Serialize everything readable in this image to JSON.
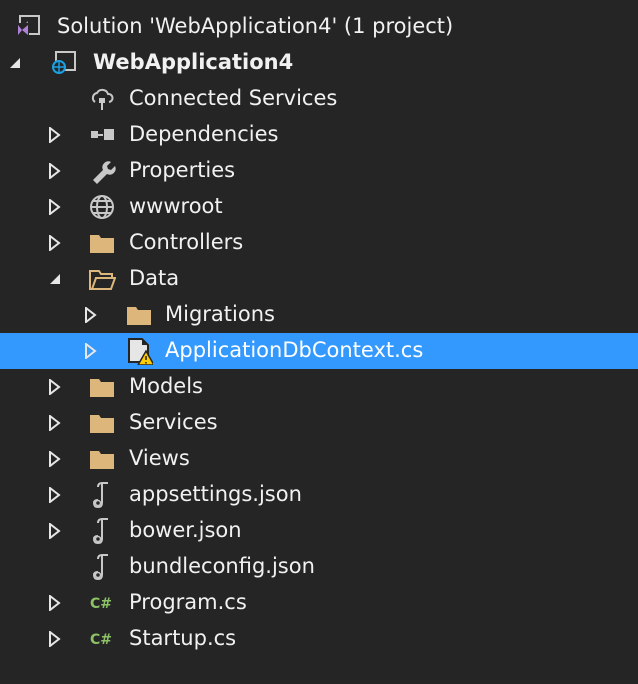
{
  "solution": {
    "label": "Solution 'WebApplication4' (1 project)"
  },
  "project": {
    "label": "WebApplication4"
  },
  "items": [
    {
      "label": "Connected Services",
      "icon": "connected-services-icon",
      "level": 2,
      "arrow": "none"
    },
    {
      "label": "Dependencies",
      "icon": "dependencies-icon",
      "level": 2,
      "arrow": "collapsed"
    },
    {
      "label": "Properties",
      "icon": "wrench-icon",
      "level": 2,
      "arrow": "collapsed"
    },
    {
      "label": "wwwroot",
      "icon": "globe-icon",
      "level": 2,
      "arrow": "collapsed"
    },
    {
      "label": "Controllers",
      "icon": "folder-icon",
      "level": 2,
      "arrow": "collapsed"
    },
    {
      "label": "Data",
      "icon": "folder-open-icon",
      "level": 2,
      "arrow": "expanded"
    },
    {
      "label": "Migrations",
      "icon": "folder-icon",
      "level": 3,
      "arrow": "collapsed"
    },
    {
      "label": "ApplicationDbContext.cs",
      "icon": "file-warning-icon",
      "level": 3,
      "arrow": "collapsed",
      "selected": true
    },
    {
      "label": "Models",
      "icon": "folder-icon",
      "level": 2,
      "arrow": "collapsed"
    },
    {
      "label": "Services",
      "icon": "folder-icon",
      "level": 2,
      "arrow": "collapsed"
    },
    {
      "label": "Views",
      "icon": "folder-icon",
      "level": 2,
      "arrow": "collapsed"
    },
    {
      "label": "appsettings.json",
      "icon": "json-icon",
      "level": 2,
      "arrow": "collapsed"
    },
    {
      "label": "bower.json",
      "icon": "json-icon",
      "level": 2,
      "arrow": "collapsed"
    },
    {
      "label": "bundleconfig.json",
      "icon": "json-icon",
      "level": 2,
      "arrow": "none"
    },
    {
      "label": "Program.cs",
      "icon": "csharp-icon",
      "level": 2,
      "arrow": "collapsed"
    },
    {
      "label": "Startup.cs",
      "icon": "csharp-icon",
      "level": 2,
      "arrow": "collapsed"
    }
  ],
  "colors": {
    "background": "#252526",
    "selection": "#3399ff",
    "folder": "#dcb67a",
    "csharp": "#8cc265",
    "vs": "#b180d7",
    "globe": "#1ba1e2",
    "warning": "#ffcc00"
  }
}
